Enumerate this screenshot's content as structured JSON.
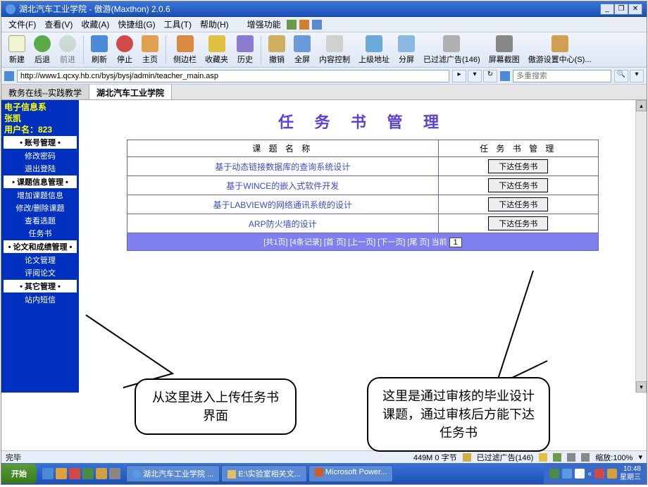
{
  "window": {
    "title": "湖北汽车工业学院 - 傲游(Maxthon) 2.0.6"
  },
  "menu": {
    "file": "文件(F)",
    "view": "查看(V)",
    "fav": "收藏(A)",
    "quick": "快捷组(G)",
    "tools": "工具(T)",
    "help": "帮助(H)",
    "enhance": "增强功能"
  },
  "toolbar": {
    "new": "新建",
    "back": "后退",
    "forward": "前进",
    "refresh": "刷新",
    "stop": "停止",
    "home": "主页",
    "sidebar": "侧边栏",
    "favmgr": "收藏夹",
    "history": "历史",
    "undo": "撤销",
    "fullscreen": "全屏",
    "content": "内容控制",
    "super": "上级地址",
    "split": "分屏",
    "adfilter": "已过滤广告(146)",
    "screenshot": "屏幕截图",
    "settings": "傲游设置中心(S)..."
  },
  "url": "http://www1.qcxy.hb.cn/bysj/bysj/admin/teacher_main.asp",
  "search_hint": "多重搜索",
  "tabs": {
    "tab1": "教务在线--实践教学",
    "tab2": "湖北汽车工业学院"
  },
  "sidebar": {
    "dept": "电子信息系",
    "teacher": "张凯",
    "user_label": "用户名：823",
    "sec_account": "• 账号管理 •",
    "chpwd": "修改密码",
    "logout": "退出登陆",
    "sec_topic": "• 课题信息管理 •",
    "addtopic": "增加课题信息",
    "modtopic": "修改/删除课题",
    "viewsel": "查看选题",
    "taskbook": "任务书",
    "sec_paper": "• 论文和成绩管理 •",
    "papermgr": "论文管理",
    "review": "评阅论文",
    "sec_other": "• 其它管理 •",
    "msg": "站内短信"
  },
  "page": {
    "title": "任 务 书 管 理",
    "col_name": "课 题 名 称",
    "col_action": "任 务 书 管 理",
    "rows": [
      {
        "name": "基于动态链接数据库的查询系统设计",
        "action": "下达任务书"
      },
      {
        "name": "基于WINCE的嵌入式软件开发",
        "action": "下达任务书"
      },
      {
        "name": "基于LABVIEW的网络通讯系统的设计",
        "action": "下达任务书"
      },
      {
        "name": "ARP防火墙的设计",
        "action": "下达任务书"
      }
    ],
    "pager": "[共1页] [4条记录] [首 页] [上一页] [下一页] [尾 页] 当前",
    "pager_num": "1"
  },
  "callouts": {
    "left": "从这里进入上传任务书界面",
    "right": "这里是通过审核的毕业设计课题，通过审核后方能下达任务书"
  },
  "status": {
    "left": "完毕",
    "bytes": "449M 0 字节",
    "adfilter": "已过滤广告(146)",
    "zoom": "缩放:100%"
  },
  "taskbar": {
    "start": "开始",
    "task1": "湖北汽车工业学院 ...",
    "task2": "E:\\实验室相关文...",
    "task3": "Microsoft Power...",
    "time": "10:48",
    "day": "星期三"
  }
}
